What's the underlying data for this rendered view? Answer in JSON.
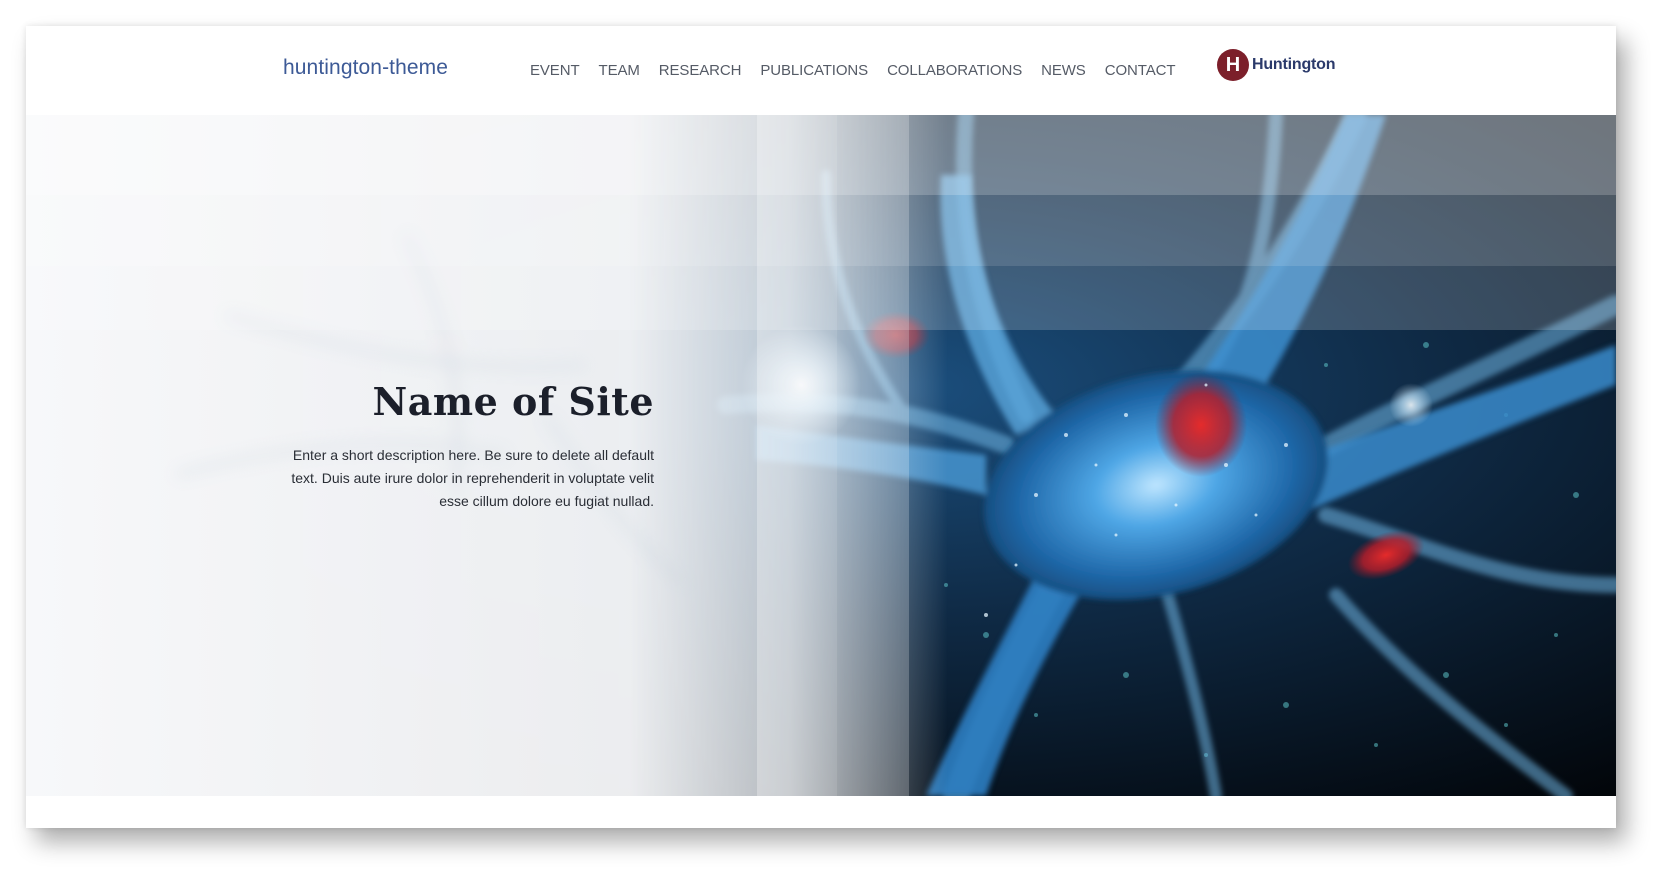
{
  "header": {
    "site_name": "huntington-theme",
    "nav": [
      {
        "label": "EVENT"
      },
      {
        "label": "TEAM"
      },
      {
        "label": "RESEARCH"
      },
      {
        "label": "PUBLICATIONS"
      },
      {
        "label": "COLLABORATIONS"
      },
      {
        "label": "NEWS"
      },
      {
        "label": "CONTACT"
      }
    ],
    "brand": {
      "mark": "H",
      "name": "Huntington",
      "color": "#7c1f2a"
    }
  },
  "hero": {
    "title": "Name of Site",
    "description": "Enter a short description here. Be sure to delete all default text. Duis aute irure dolor in reprehenderit in voluptate velit esse cillum dolore eu fugiat nullad.",
    "image": "neuron-cell-illustration"
  },
  "colors": {
    "site_name": "#3d5a96",
    "nav_text": "#555b66",
    "title_text": "#1b1f2a"
  }
}
